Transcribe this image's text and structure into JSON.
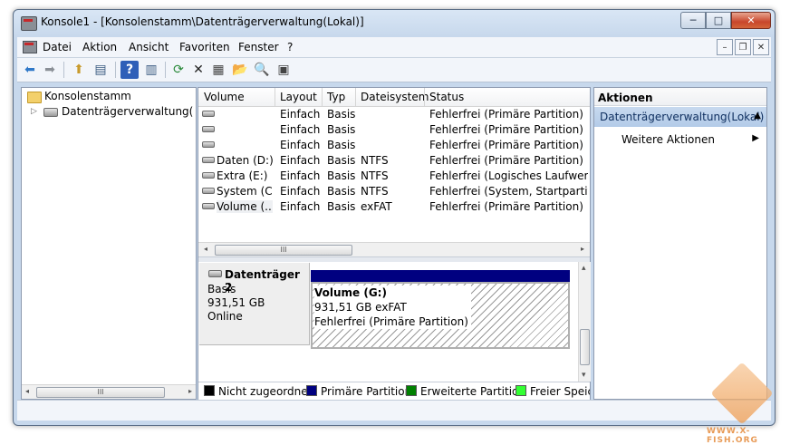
{
  "window": {
    "title": "Konsole1 - [Konsolenstamm\\Datenträgerverwaltung(Lokal)]",
    "caption_min": "─",
    "caption_max": "□",
    "caption_close": "✕"
  },
  "menu": {
    "items": [
      "Datei",
      "Aktion",
      "Ansicht",
      "Favoriten",
      "Fenster",
      "?"
    ],
    "mdi_min": "–",
    "mdi_restore": "❐",
    "mdi_close": "✕"
  },
  "toolbar": {
    "icons": [
      "back-arrow-icon",
      "forward-arrow-icon",
      "up-folder-icon",
      "show-hide-tree-icon",
      "help-icon",
      "show-hide-action-pane-icon",
      "refresh-icon",
      "delete-icon",
      "properties-icon",
      "open-folder-icon",
      "search-disk-icon",
      "disk-settings-icon"
    ],
    "glyphs": [
      "⬅",
      "➡",
      "⬆",
      "▤",
      "?",
      "▥",
      "⟳",
      "✕",
      "▦",
      "📂",
      "🔍",
      "▣"
    ]
  },
  "tree": {
    "root": "Konsolenstamm",
    "child": "Datenträgerverwaltung(Lokal)",
    "expander": "▷",
    "scroll_left": "◂",
    "scroll_right": "▸",
    "thumb": "III"
  },
  "volumes": {
    "headers": [
      "Volume",
      "Layout",
      "Typ",
      "Dateisystem",
      "Status"
    ],
    "rows": [
      {
        "volume": "",
        "layout": "Einfach",
        "type": "Basis",
        "fs": "",
        "status": "Fehlerfrei (Primäre Partition)"
      },
      {
        "volume": "",
        "layout": "Einfach",
        "type": "Basis",
        "fs": "",
        "status": "Fehlerfrei (Primäre Partition)"
      },
      {
        "volume": "",
        "layout": "Einfach",
        "type": "Basis",
        "fs": "",
        "status": "Fehlerfrei (Primäre Partition)"
      },
      {
        "volume": "Daten (D:)",
        "layout": "Einfach",
        "type": "Basis",
        "fs": "NTFS",
        "status": "Fehlerfrei (Primäre Partition)"
      },
      {
        "volume": "Extra (E:)",
        "layout": "Einfach",
        "type": "Basis",
        "fs": "NTFS",
        "status": "Fehlerfrei (Logisches Laufwerk)"
      },
      {
        "volume": "System (C:)",
        "layout": "Einfach",
        "type": "Basis",
        "fs": "NTFS",
        "status": "Fehlerfrei (System, Startpartition, ..."
      },
      {
        "volume": "Volume (...",
        "layout": "Einfach",
        "type": "Basis",
        "fs": "exFAT",
        "status": "Fehlerfrei (Primäre Partition)"
      }
    ],
    "scroll_thumb": "III",
    "scroll_left": "◂",
    "scroll_right": "▸"
  },
  "disk": {
    "name": "Datenträger 2",
    "type": "Basis",
    "size": "931,51 GB",
    "state": "Online",
    "partition": {
      "name": "Volume  (G:)",
      "size_fs": "931,51 GB exFAT",
      "status": "Fehlerfrei (Primäre Partition)"
    },
    "scroll_up": "▴",
    "scroll_down": "▾"
  },
  "legend": [
    {
      "label": "Nicht zugeordnet",
      "color": "#000000"
    },
    {
      "label": "Primäre Partition",
      "color": "#000080"
    },
    {
      "label": "Erweiterte Partition",
      "color": "#008000"
    },
    {
      "label": "Freier Speich",
      "color": "#33ff33"
    }
  ],
  "actions": {
    "header": "Aktionen",
    "section": "Datenträgerverwaltung(Lokal)",
    "section_toggle": "▲",
    "item": "Weitere Aktionen",
    "item_arrow": "▶"
  },
  "watermark": "WWW.X-FISH.ORG"
}
